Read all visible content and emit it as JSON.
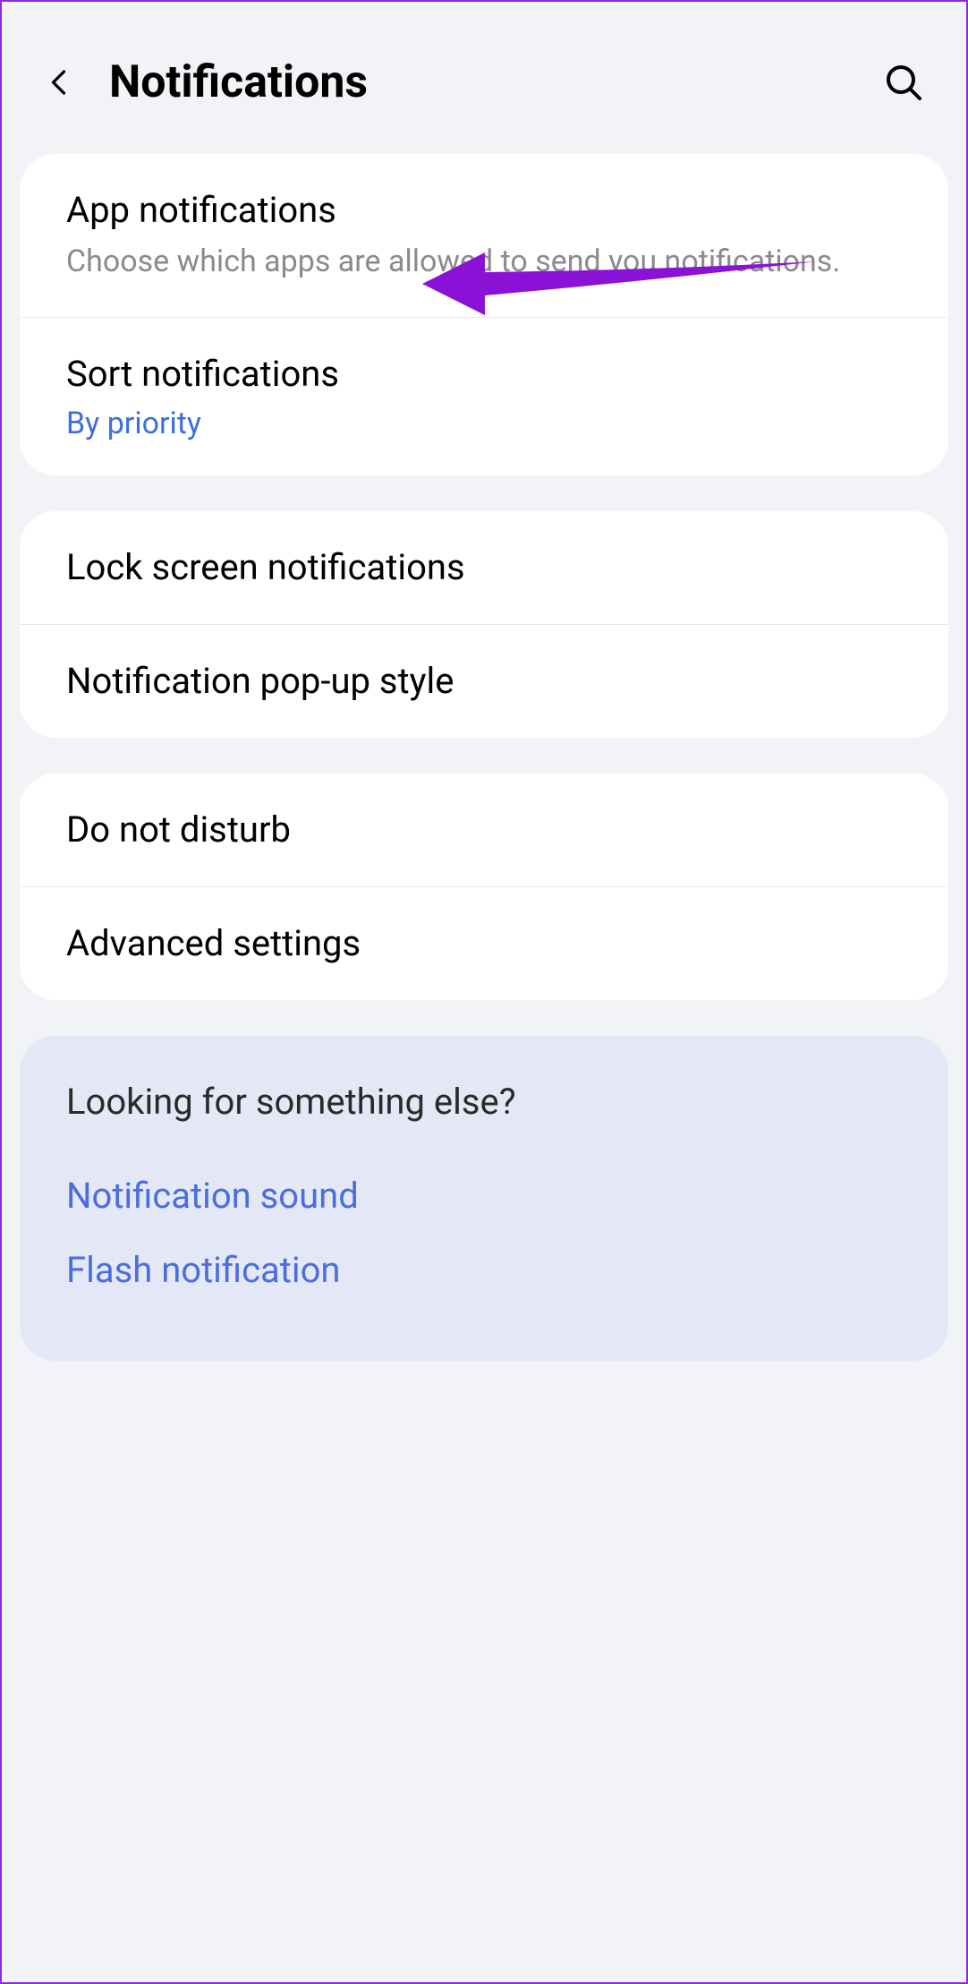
{
  "header": {
    "title": "Notifications"
  },
  "group1": {
    "app_notifications": {
      "title": "App notifications",
      "subtitle": "Choose which apps are allowed to send you notifications."
    },
    "sort_notifications": {
      "title": "Sort notifications",
      "value": "By priority"
    }
  },
  "group2": {
    "lock_screen": {
      "title": "Lock screen notifications"
    },
    "popup_style": {
      "title": "Notification pop-up style"
    }
  },
  "group3": {
    "dnd": {
      "title": "Do not disturb"
    },
    "advanced": {
      "title": "Advanced settings"
    }
  },
  "looking": {
    "title": "Looking for something else?",
    "links": {
      "sound": "Notification sound",
      "flash": "Flash notification"
    }
  },
  "annotation": {
    "arrow_color": "#8a12d6"
  }
}
